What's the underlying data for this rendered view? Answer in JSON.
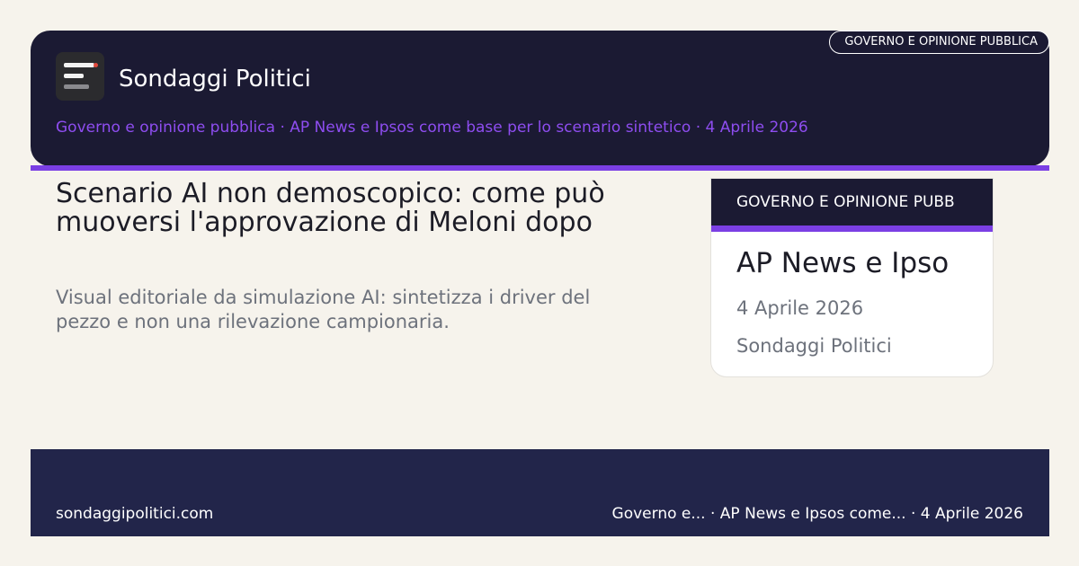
{
  "header": {
    "brand": "Sondaggi Politici",
    "subline": "Governo e opinione pubblica · AP News e Ipsos come base per lo scenario sintetico · 4 Aprile 2026",
    "pill": "GOVERNO E OPINIONE PUBBLICA"
  },
  "logo": {
    "icon": "bars-logo-icon",
    "colors": {
      "background": "#2b2b2e",
      "bars": "#f2f2f2",
      "dot": "#e0483c"
    }
  },
  "article": {
    "headline": "Scenario AI non demoscopico: come può muoversi l'approvazione di Meloni dopo",
    "description": "Visual editoriale da simulazione AI: sintetizza i driver del pezzo e non una rilevazione campionaria."
  },
  "card": {
    "category": "GOVERNO E OPINIONE PUBB",
    "title": "AP News e Ipso",
    "date": "4 Aprile 2026",
    "source": "Sondaggi Politici"
  },
  "footer": {
    "site": "sondaggipolitici.com",
    "meta": "Governo e... · AP News e Ipsos come... · 4 Aprile 2026"
  },
  "colors": {
    "page_background": "#f6f3ec",
    "header_background": "#1b1a33",
    "accent": "#7b3fe4",
    "subline_text": "#8e4df0",
    "footer_background": "#22254a",
    "muted_text": "#6d727c"
  }
}
